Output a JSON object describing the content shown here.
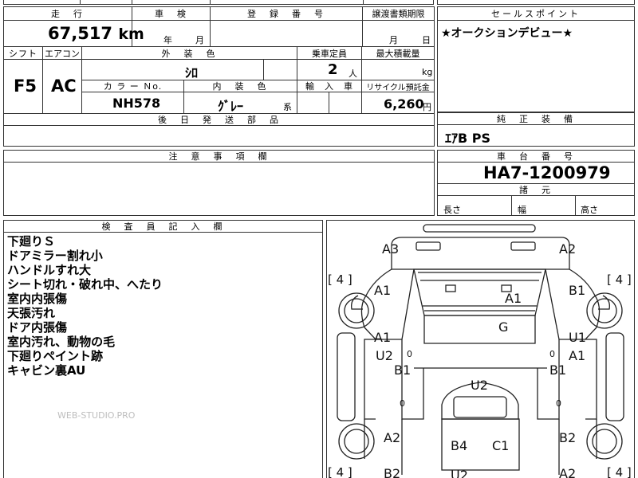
{
  "header": {
    "mileage_label": "走　行",
    "inspection_label": "車　検",
    "registration_label": "登　録　番　号",
    "transfer_label": "譲渡書類期限",
    "sales_point_label": "セールスポイント"
  },
  "mileage": {
    "value": "67,517",
    "unit": "km"
  },
  "inspection": {
    "year_unit": "年",
    "month_unit": "月"
  },
  "transfer": {
    "month_unit": "月",
    "day_unit": "日"
  },
  "sales_point_text": "★オークションデビュー★",
  "row2": {
    "shift_label": "シフト",
    "aircon_label": "エアコン",
    "exterior_color_label": "外　装　色",
    "capacity_label": "乗車定員",
    "max_load_label": "最大積載量",
    "shift_value": "F5",
    "aircon_value": "AC",
    "exterior_color_value": "ｼﾛ",
    "capacity_value": "2",
    "capacity_unit": "人",
    "max_load_unit": "kg"
  },
  "row3": {
    "color_no_label": "カ ラ ー Ｎo.",
    "interior_color_label": "内　装　色",
    "import_label": "輸　入　車",
    "recycle_label": "リサイクル預託金",
    "color_no_value": "NH578",
    "interior_color_value": "ｸﾞﾚｰ",
    "interior_suffix": "系",
    "recycle_value": "6,260",
    "recycle_unit": "円"
  },
  "parts": {
    "label": "後　日　発　送　部　品"
  },
  "genuine": {
    "label": "純　正　装　備",
    "value": "ｴｱB PS"
  },
  "notes": {
    "label": "注　意　事　項　欄"
  },
  "chassis": {
    "label": "車　台　番　号",
    "value": "HA7-1200979",
    "dims_label": "諸　元",
    "length_label": "長さ",
    "width_label": "幅",
    "height_label": "高さ"
  },
  "inspector": {
    "label": "検　査　員　記　入　欄",
    "lines": [
      "下廻りＳ",
      "ドアミラー割れ小",
      "ハンドルすれ大",
      "シート切れ・破れ中、へたり",
      "室内内張傷",
      "天張汚れ",
      "ドア内張傷",
      "室内汚れ、動物の毛",
      "下廻りペイント跡",
      "キャビン裏AU"
    ]
  },
  "watermark": "WEB-STUDIO.PRO",
  "diagram": {
    "marks": [
      "A3",
      "A2",
      "A1",
      "A1",
      "B1",
      "G",
      "A1",
      "U2",
      "B1",
      "U1",
      "A1",
      "B1",
      "U2",
      "A2",
      "B2",
      "B4",
      "C1",
      "B2",
      "A2",
      "U2"
    ],
    "tire_left_top": "[ 4 ]",
    "tire_right_top": "[ 4 ]",
    "tire_left_bottom": "[ 4 ]",
    "tire_right_bottom": "[ 4 ]",
    "zero_marks": [
      "0",
      "0",
      "0",
      "0"
    ]
  }
}
